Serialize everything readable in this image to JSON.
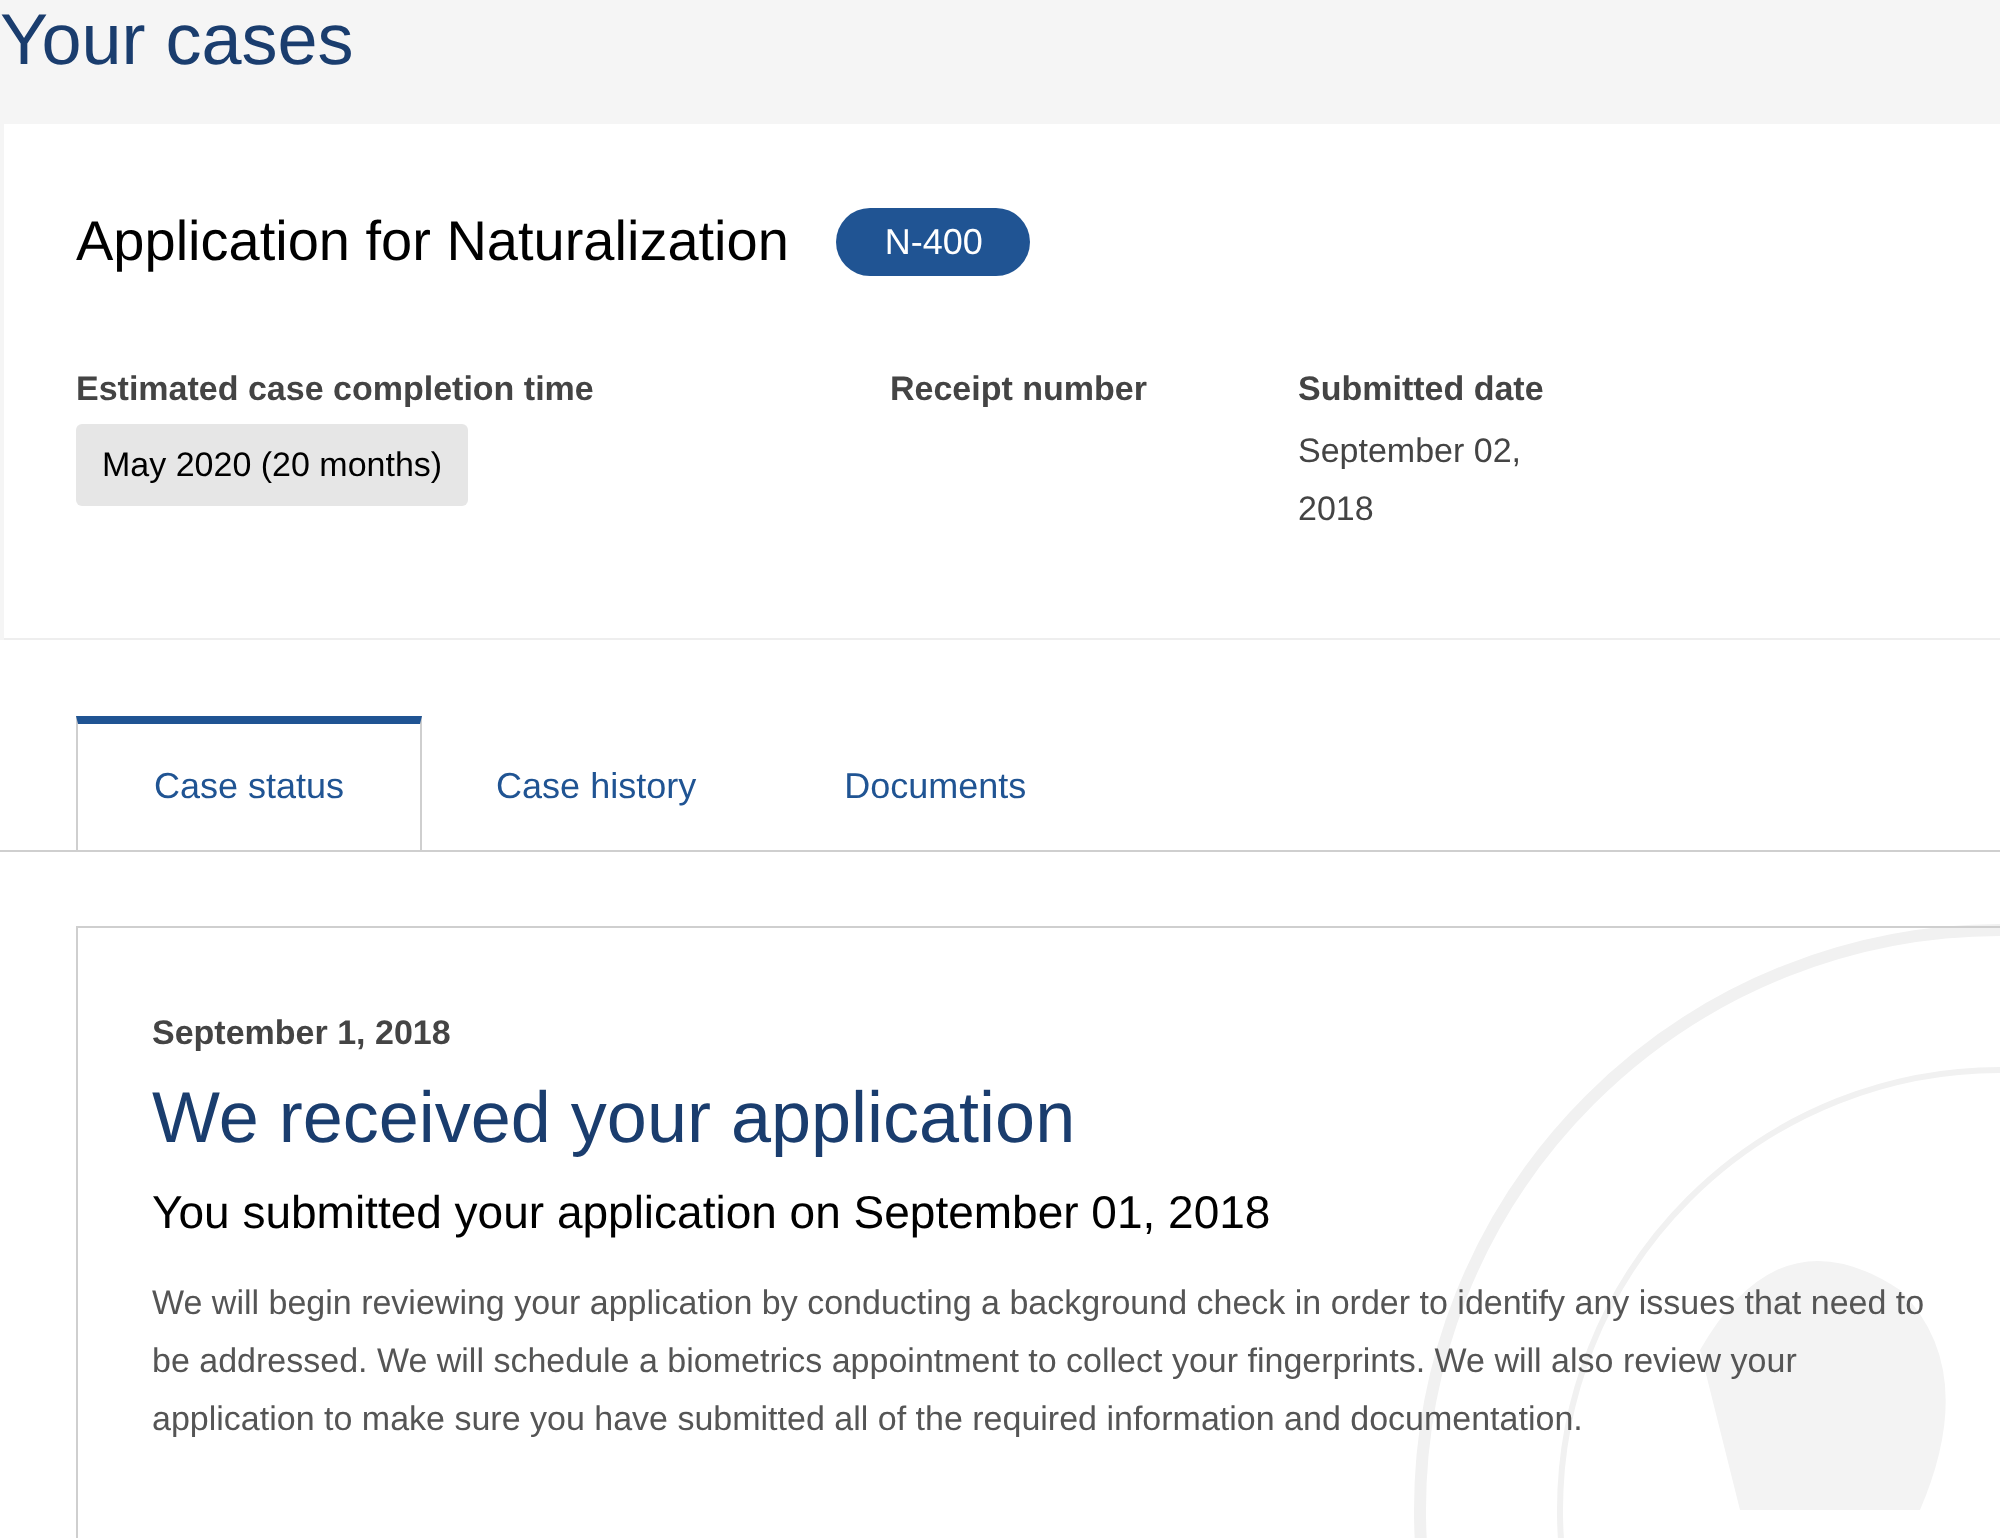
{
  "page_title": "Your cases",
  "case": {
    "title": "Application for Naturalization",
    "form_badge": "N-400",
    "fields": [
      {
        "label": "Estimated case completion time",
        "value": "May 2020 (20 months)",
        "kind": "highlight"
      },
      {
        "label": "Receipt number"
      },
      {
        "label": "Submitted date",
        "value": "September 02, 2018",
        "kind": "plain"
      }
    ]
  },
  "tabs": [
    {
      "label": "Case status",
      "selected": true
    },
    {
      "label": "Case history",
      "selected": false
    },
    {
      "label": "Documents",
      "selected": false
    }
  ],
  "status": {
    "date": "September 1, 2018",
    "heading": "We received your application",
    "subheading": "You submitted your application on September 01, 2018",
    "body": "We will begin reviewing your application by conducting a background check in order to identify any issues that need to be addressed. We will schedule a biometrics appointment to collect your fingerprints. We will also review your application to make sure you have submitted all of the required information and documentation."
  }
}
